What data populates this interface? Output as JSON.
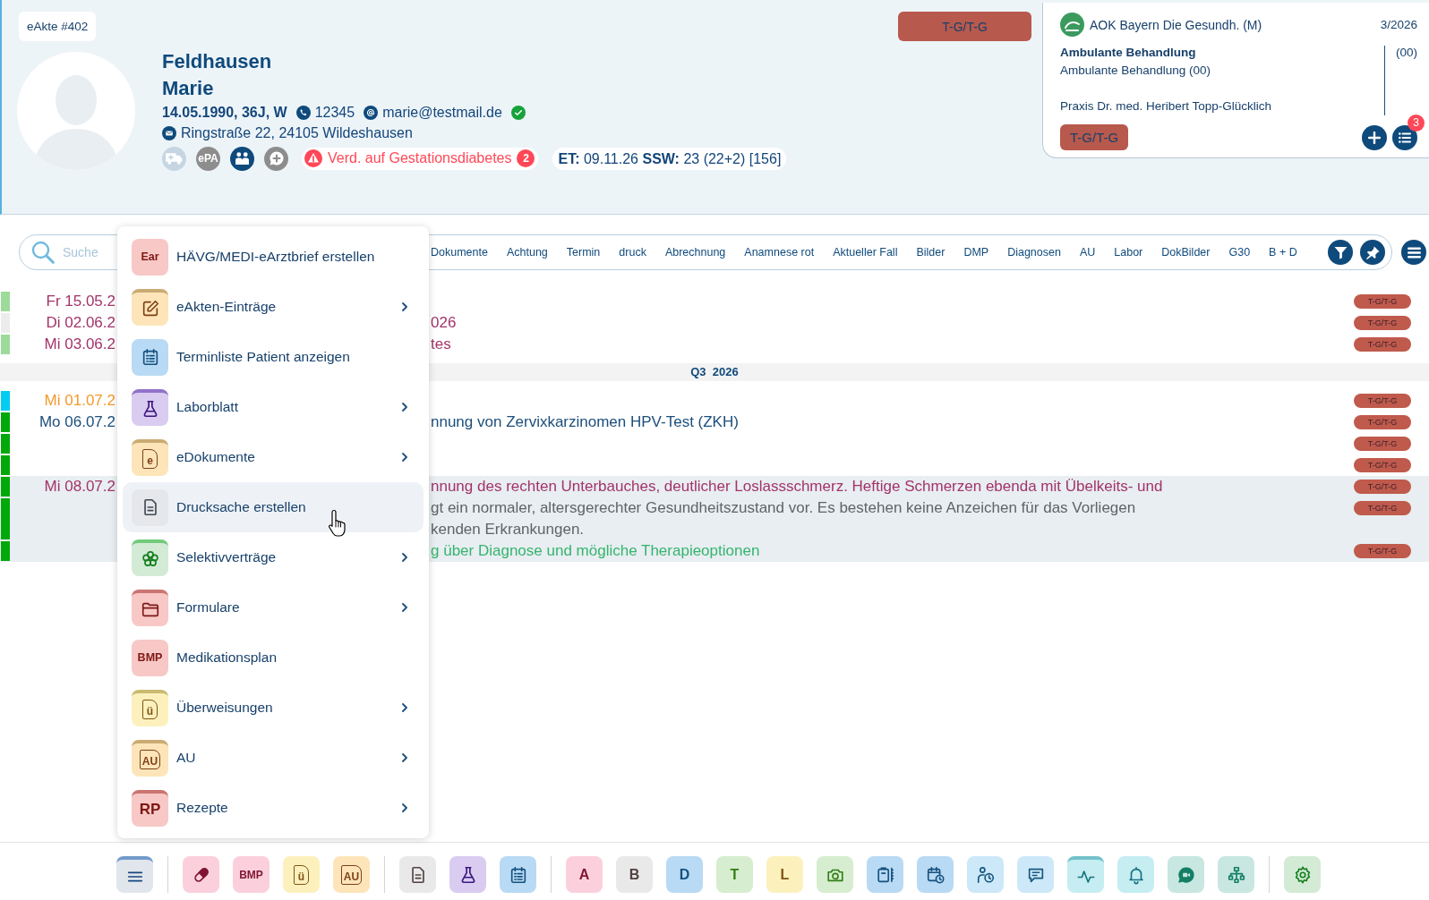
{
  "header": {
    "record_badge": "eAkte #402",
    "last_name": "Feldhausen",
    "first_name": "Marie",
    "birth_info": "14.05.1990, 36J, W",
    "phone": "12345",
    "email": "marie@testmail.de",
    "email_verified": true,
    "address": "Ringstraße 22, 24105 Wildeshausen",
    "status_icons": [
      {
        "kind": "ambulance",
        "color": "#c5d6e2"
      },
      {
        "kind": "text",
        "label": "ePA",
        "color": "#8d8d8d"
      },
      {
        "kind": "family",
        "color": "#0f4a7c"
      },
      {
        "kind": "chat-plus",
        "color": "#8d8d8d"
      }
    ],
    "warning": {
      "text": "Verd. auf Gestationsdiabetes",
      "count": "2"
    },
    "pregnancy": "**ET:** 09.11.26 **SSW:** 23 (22+2) [156]",
    "case_button": "T-G/T-G"
  },
  "insurance_card": {
    "name": "AOK Bayern Die Gesundh. (M)",
    "quarter": "3/2026",
    "treatment_title": "Ambulante Behandlung",
    "treatment": "Ambulante Behandlung (00)",
    "code": "(00)",
    "practice": "Praxis Dr. med. Heribert Topp-Glücklich",
    "tag": "T-G/T-G",
    "list_count": "3"
  },
  "filter_bar": {
    "search": {
      "placeholder": "Suche"
    },
    "tabs": [
      {
        "label": "Dokumente",
        "selected": false
      },
      {
        "label": "Achtung",
        "selected": false
      },
      {
        "label": "Termin",
        "selected": false
      },
      {
        "label": "druck",
        "selected": false
      },
      {
        "label": "Abrechnung",
        "selected": false
      },
      {
        "label": "Anamnese rot",
        "selected": false
      },
      {
        "label": "Aktueller Fall",
        "selected": false
      },
      {
        "label": "Bilder",
        "selected": false
      },
      {
        "label": "DMP",
        "selected": false
      },
      {
        "label": "Diagnosen",
        "selected": false
      },
      {
        "label": "AU",
        "selected": false
      },
      {
        "label": "Labor",
        "selected": false
      },
      {
        "label": "DokBilder",
        "selected": false
      },
      {
        "label": "G30",
        "selected": false
      },
      {
        "label": "B + D",
        "selected": false
      }
    ]
  },
  "timeline": {
    "sections": [
      {
        "visits": [
          {
            "date": {
              "text": "Fr 15.05.2",
              "color": "#a3336a"
            },
            "selected": false,
            "entries": [
              {
                "color": "#9ddb9b",
                "tag": "T-G/T-G"
              }
            ]
          },
          {
            "date": {
              "text": "Di 02.06.2",
              "color": "#a3336a"
            },
            "selected": false,
            "entries": [
              {
                "color": "#ececec",
                "text": {
                  "lines": [
                    "026"
                  ],
                  "color": "#a3336a"
                },
                "tag": "T-G/T-G"
              }
            ]
          },
          {
            "date": {
              "text": "Mi 03.06.2",
              "color": "#a3336a"
            },
            "selected": false,
            "entries": [
              {
                "color": "#9ddb9b",
                "text": {
                  "lines": [
                    "tes"
                  ],
                  "color": "#a3336a"
                },
                "tag": "T-G/T-G"
              }
            ]
          }
        ]
      },
      {
        "heading": "Q3  2026",
        "visits": [
          {
            "date": {
              "text": "Mi 01.07.2",
              "color": "#f4992c"
            },
            "selected": false,
            "entries": [
              {
                "color": "#00cdef",
                "tag": "T-G/T-G"
              }
            ]
          },
          {
            "date": {
              "text": "Mo 06.07.2",
              "color": "#1c4f7c"
            },
            "selected": false,
            "entries": [
              {
                "color": "#00a80a",
                "text": {
                  "lines": [
                    "nnung von Zervixkarzinomen HPV-Test (ZKH)"
                  ],
                  "color": "#1c4f7c"
                },
                "tag": "T-G/T-G"
              },
              {
                "color": "#00a80a",
                "tag": "T-G/T-G"
              },
              {
                "color": "#00a80a",
                "tag": "T-G/T-G"
              }
            ]
          },
          {
            "date": {
              "text": "Mi 08.07.2",
              "color": "#a3336a"
            },
            "selected": true,
            "entries": [
              {
                "color": "#00a80a",
                "text": {
                  "lines": [
                    "nnung des rechten Unterbauches, deutlicher Loslassschmerz. Heftige Schmerzen ebenda mit Übelkeits- und"
                  ],
                  "color": "#a3336a"
                },
                "tag": "T-G/T-G"
              },
              {
                "color": "#00a80a",
                "text": {
                  "lines": [
                    "gt ein normaler, altersgerechter Gesundheitszustand vor. Es bestehen keine Anzeichen für das Vorliegen",
                    "kenden Erkrankungen."
                  ],
                  "color": "#5f6468"
                },
                "tag": "T-G/T-G"
              },
              {
                "color": "#00a80a",
                "text": {
                  "lines": [
                    "g über Diagnose und mögliche Therapieoptionen"
                  ],
                  "color": "#36b46f"
                },
                "tag": "T-G/T-G"
              }
            ]
          }
        ]
      }
    ]
  },
  "context_menu": {
    "items": [
      {
        "kind": "text",
        "icon_text": "Ear",
        "color": "#f7c8c6",
        "label": "HÄVG/MEDI-eArztbrief erstellen",
        "submenu": false,
        "hovered": false
      },
      {
        "kind": "edit",
        "color": "#fde5b9",
        "label": "eAkten-Einträge",
        "submenu": true,
        "hovered": false
      },
      {
        "kind": "calendar-list",
        "color": "#b8daf4",
        "label": "Terminliste Patient anzeigen",
        "submenu": false,
        "hovered": false
      },
      {
        "kind": "flask",
        "color": "#d9ccf0",
        "label": "Laborblatt",
        "submenu": true,
        "hovered": false
      },
      {
        "kind": "doc-text",
        "icon_text": "e",
        "color": "#fde5b9",
        "label": "eDokumente",
        "submenu": true,
        "hovered": false
      },
      {
        "kind": "document",
        "color": "#e5e7ea",
        "label": "Drucksache erstellen",
        "submenu": false,
        "hovered": true
      },
      {
        "kind": "flower",
        "color": "#d3ead5",
        "label": "Selektivverträge",
        "submenu": true,
        "hovered": false
      },
      {
        "kind": "folder",
        "color": "#f7c8c6",
        "label": "Formulare",
        "submenu": true,
        "hovered": false
      },
      {
        "kind": "text",
        "icon_text": "BMP",
        "color": "#f7c8c6",
        "label": "Medikationsplan",
        "submenu": false,
        "hovered": false
      },
      {
        "kind": "doc-text",
        "icon_text": "ü",
        "color": "#fcf1bd",
        "label": "Überweisungen",
        "submenu": true,
        "hovered": false
      },
      {
        "kind": "doc-text",
        "icon_text": "AU",
        "color": "#fde5b9",
        "label": "AU",
        "submenu": true,
        "hovered": false
      },
      {
        "kind": "text",
        "icon_text": "RP",
        "color": "#f7c8c6",
        "label": "Rezepte",
        "submenu": true,
        "hovered": false
      }
    ]
  },
  "toolbar": {
    "groups": [
      {
        "buttons": [
          {
            "kind": "menu",
            "color": "#e1e6ec",
            "active": true
          }
        ]
      },
      {
        "buttons": [
          {
            "kind": "pill",
            "color": "#fbd0dc",
            "active": false
          },
          {
            "kind": "text",
            "text": "BMP",
            "color": "#fbd0dc",
            "active": false
          },
          {
            "kind": "doc-text",
            "text": "ü",
            "color": "#fcf1bd",
            "active": false
          },
          {
            "kind": "doc-text",
            "text": "AU",
            "color": "#fde5b9",
            "active": false
          }
        ]
      },
      {
        "buttons": [
          {
            "kind": "document",
            "color": "#e9e9e9",
            "active": false
          },
          {
            "kind": "flask",
            "color": "#d9ccf0",
            "active": false
          },
          {
            "kind": "calendar-list",
            "color": "#b8daf4",
            "active": false
          }
        ]
      },
      {
        "buttons": [
          {
            "kind": "text",
            "text": "A",
            "color": "#fbd0dc",
            "active": false
          },
          {
            "kind": "text",
            "text": "B",
            "color": "#e9e9e9",
            "active": false
          },
          {
            "kind": "text",
            "text": "D",
            "color": "#b8daf4",
            "active": false
          },
          {
            "kind": "text",
            "text": "T",
            "color": "#d7edcf",
            "active": false
          },
          {
            "kind": "text",
            "text": "L",
            "color": "#fcf1bd",
            "active": false
          },
          {
            "kind": "camera",
            "color": "#d7edcf",
            "active": false
          },
          {
            "kind": "clipboard",
            "color": "#b8daf4",
            "active": false
          },
          {
            "kind": "calendar-clock",
            "color": "#b8daf4",
            "active": false
          },
          {
            "kind": "person-clock",
            "color": "#cde8f8",
            "active": false
          },
          {
            "kind": "chat",
            "color": "#cde8f8",
            "active": false
          },
          {
            "kind": "pulse",
            "color": "#c5edf2",
            "active": true
          },
          {
            "kind": "bell",
            "color": "#c5edf2",
            "active": false
          },
          {
            "kind": "chat-filled",
            "color": "#c8e7e0",
            "active": false
          },
          {
            "kind": "hierarchy",
            "color": "#c8e7e0",
            "active": false
          }
        ]
      },
      {
        "buttons": [
          {
            "kind": "gear",
            "color": "#d3ead5",
            "active": false
          }
        ]
      }
    ]
  }
}
